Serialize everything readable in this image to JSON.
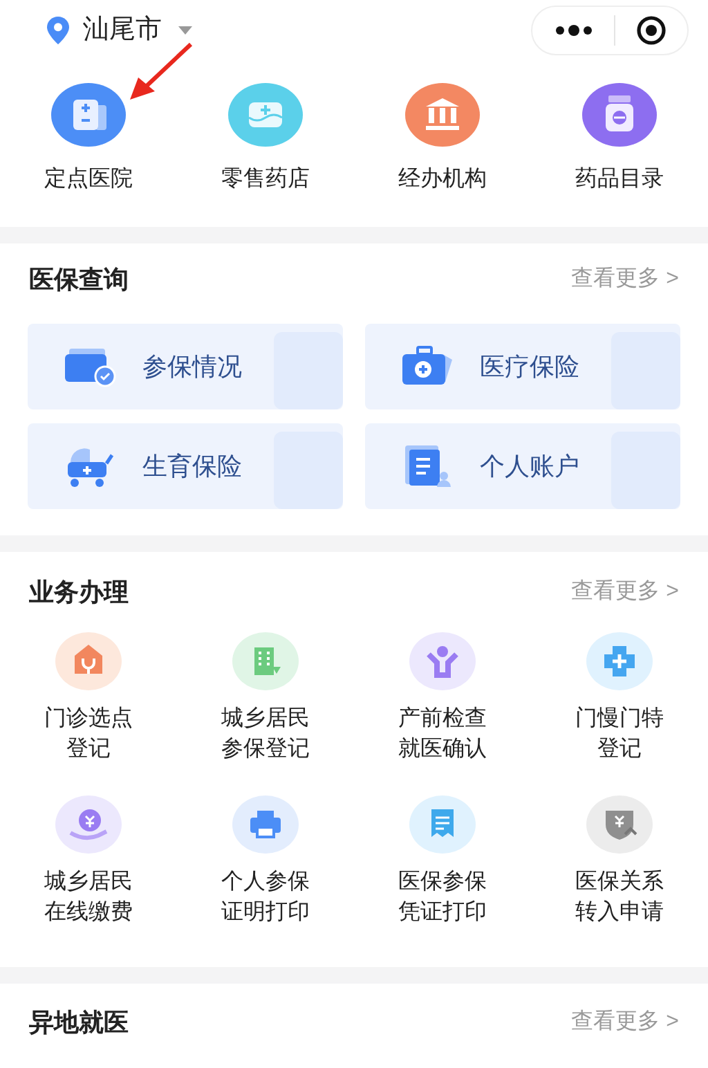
{
  "location": {
    "city": "汕尾市"
  },
  "quick_links": [
    {
      "label": "定点医院"
    },
    {
      "label": "零售药店"
    },
    {
      "label": "经办机构"
    },
    {
      "label": "药品目录"
    }
  ],
  "query_section": {
    "title": "医保查询",
    "more": "查看更多 >",
    "cards": [
      {
        "label": "参保情况"
      },
      {
        "label": "医疗保险"
      },
      {
        "label": "生育保险"
      },
      {
        "label": "个人账户"
      }
    ]
  },
  "business_section": {
    "title": "业务办理",
    "more": "查看更多 >",
    "items": [
      {
        "label": "门诊选点登记"
      },
      {
        "label": "城乡居民参保登记"
      },
      {
        "label": "产前检查就医确认"
      },
      {
        "label": "门慢门特登记"
      },
      {
        "label": "城乡居民在线缴费"
      },
      {
        "label": "个人参保证明打印"
      },
      {
        "label": "医保参保凭证打印"
      },
      {
        "label": "医保关系转入申请"
      }
    ]
  },
  "remote_section": {
    "title": "异地就医",
    "more": "查看更多 >"
  }
}
